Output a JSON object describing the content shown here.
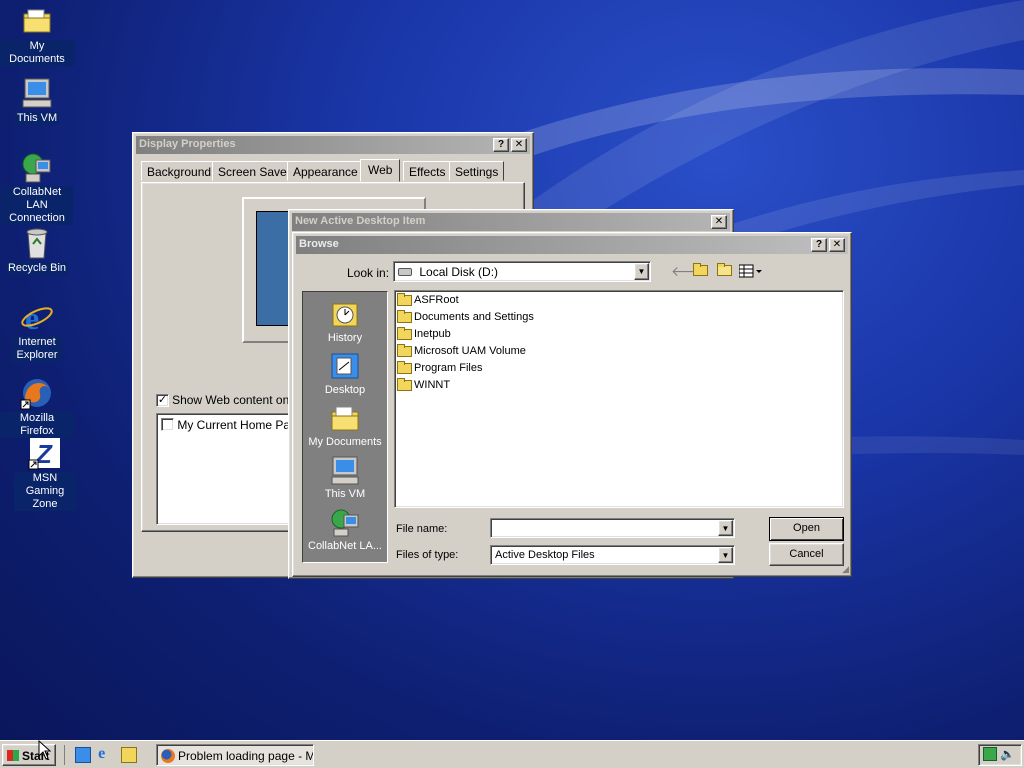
{
  "desktop": {
    "icons": [
      {
        "label": "My Documents"
      },
      {
        "label": "This VM"
      },
      {
        "label": "CollabNet LAN Connection"
      },
      {
        "label": "Recycle Bin"
      },
      {
        "label": "Internet Explorer"
      },
      {
        "label": "Mozilla Firefox"
      },
      {
        "label": "MSN Gaming Zone"
      }
    ]
  },
  "display_properties": {
    "title": "Display Properties",
    "tabs": [
      "Background",
      "Screen Saver",
      "Appearance",
      "Web",
      "Effects",
      "Settings"
    ],
    "selected_tab": "Web",
    "show_web_content_label": "Show Web content on m",
    "show_web_content_checked": true,
    "list_items": [
      {
        "label": "My Current Home Page",
        "checked": false
      }
    ]
  },
  "new_item_dialog": {
    "title": "New Active Desktop Item"
  },
  "browse": {
    "title": "Browse",
    "look_in_label": "Look in:",
    "look_in_value": "Local Disk (D:)",
    "places": [
      "History",
      "Desktop",
      "My Documents",
      "This VM",
      "CollabNet LA..."
    ],
    "files": [
      "ASFRoot",
      "Documents and Settings",
      "Inetpub",
      "Microsoft UAM Volume",
      "Program Files",
      "WINNT"
    ],
    "file_name_label": "File name:",
    "file_name_value": "",
    "files_of_type_label": "Files of type:",
    "files_of_type_value": "Active Desktop Files",
    "open_label": "Open",
    "cancel_label": "Cancel"
  },
  "taskbar": {
    "start_label": "Start",
    "task_label": "Problem loading page - M..."
  }
}
